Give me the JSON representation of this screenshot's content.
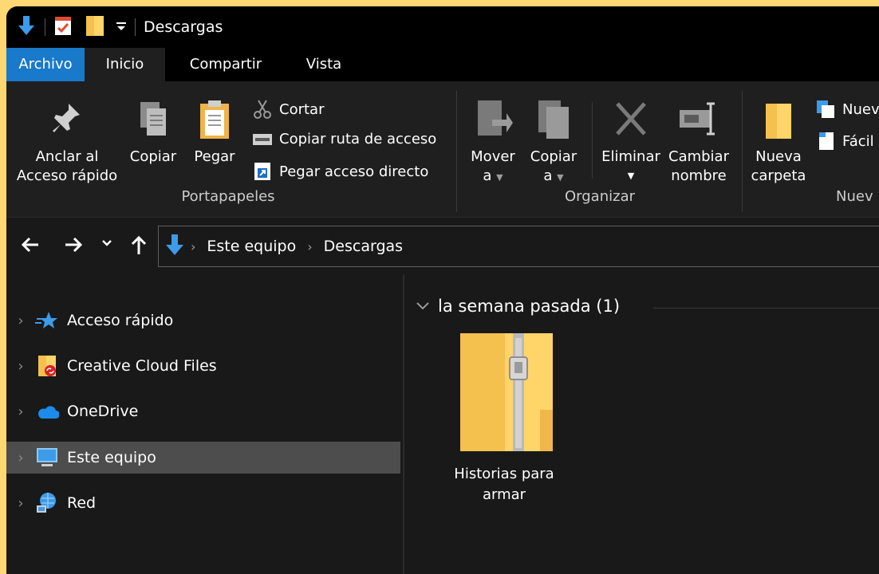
{
  "window": {
    "title": "Descargas"
  },
  "tabs": [
    "Archivo",
    "Inicio",
    "Compartir",
    "Vista"
  ],
  "ribbon": {
    "portapapeles": {
      "pin_line1": "Anclar al",
      "pin_line2": "Acceso rápido",
      "copy": "Copiar",
      "paste": "Pegar",
      "cut": "Cortar",
      "copy_path": "Copiar ruta de acceso",
      "paste_shortcut": "Pegar acceso directo",
      "label": "Portapapeles"
    },
    "organizar": {
      "move_line1": "Mover",
      "move_line2": "a",
      "copyto_line1": "Copiar",
      "copyto_line2": "a",
      "delete": "Eliminar",
      "rename_line1": "Cambiar",
      "rename_line2": "nombre",
      "label": "Organizar"
    },
    "nuevo": {
      "folder_line1": "Nueva",
      "folder_line2": "carpeta",
      "new_item": "Nuev",
      "easy_access": "Fácil",
      "label": "Nuev"
    }
  },
  "address": {
    "breadcrumbs": [
      "Este equipo",
      "Descargas"
    ]
  },
  "navpane": {
    "items": [
      {
        "label": "Acceso rápido",
        "icon": "star-icon"
      },
      {
        "label": "Creative Cloud Files",
        "icon": "creative-cloud-folder-icon"
      },
      {
        "label": "OneDrive",
        "icon": "cloud-icon"
      },
      {
        "label": "Este equipo",
        "icon": "computer-icon",
        "selected": true
      },
      {
        "label": "Red",
        "icon": "network-icon"
      }
    ]
  },
  "content": {
    "group_header": "la semana pasada (1)",
    "files": [
      {
        "name_line1": "Historias para",
        "name_line2": "armar",
        "icon": "zip-folder-icon"
      }
    ]
  },
  "colors": {
    "accent": "#1979CA",
    "background": "#191919",
    "ribbon": "#1f1f1f",
    "selected": "#4d4d4d",
    "frame": "#FFD773"
  }
}
